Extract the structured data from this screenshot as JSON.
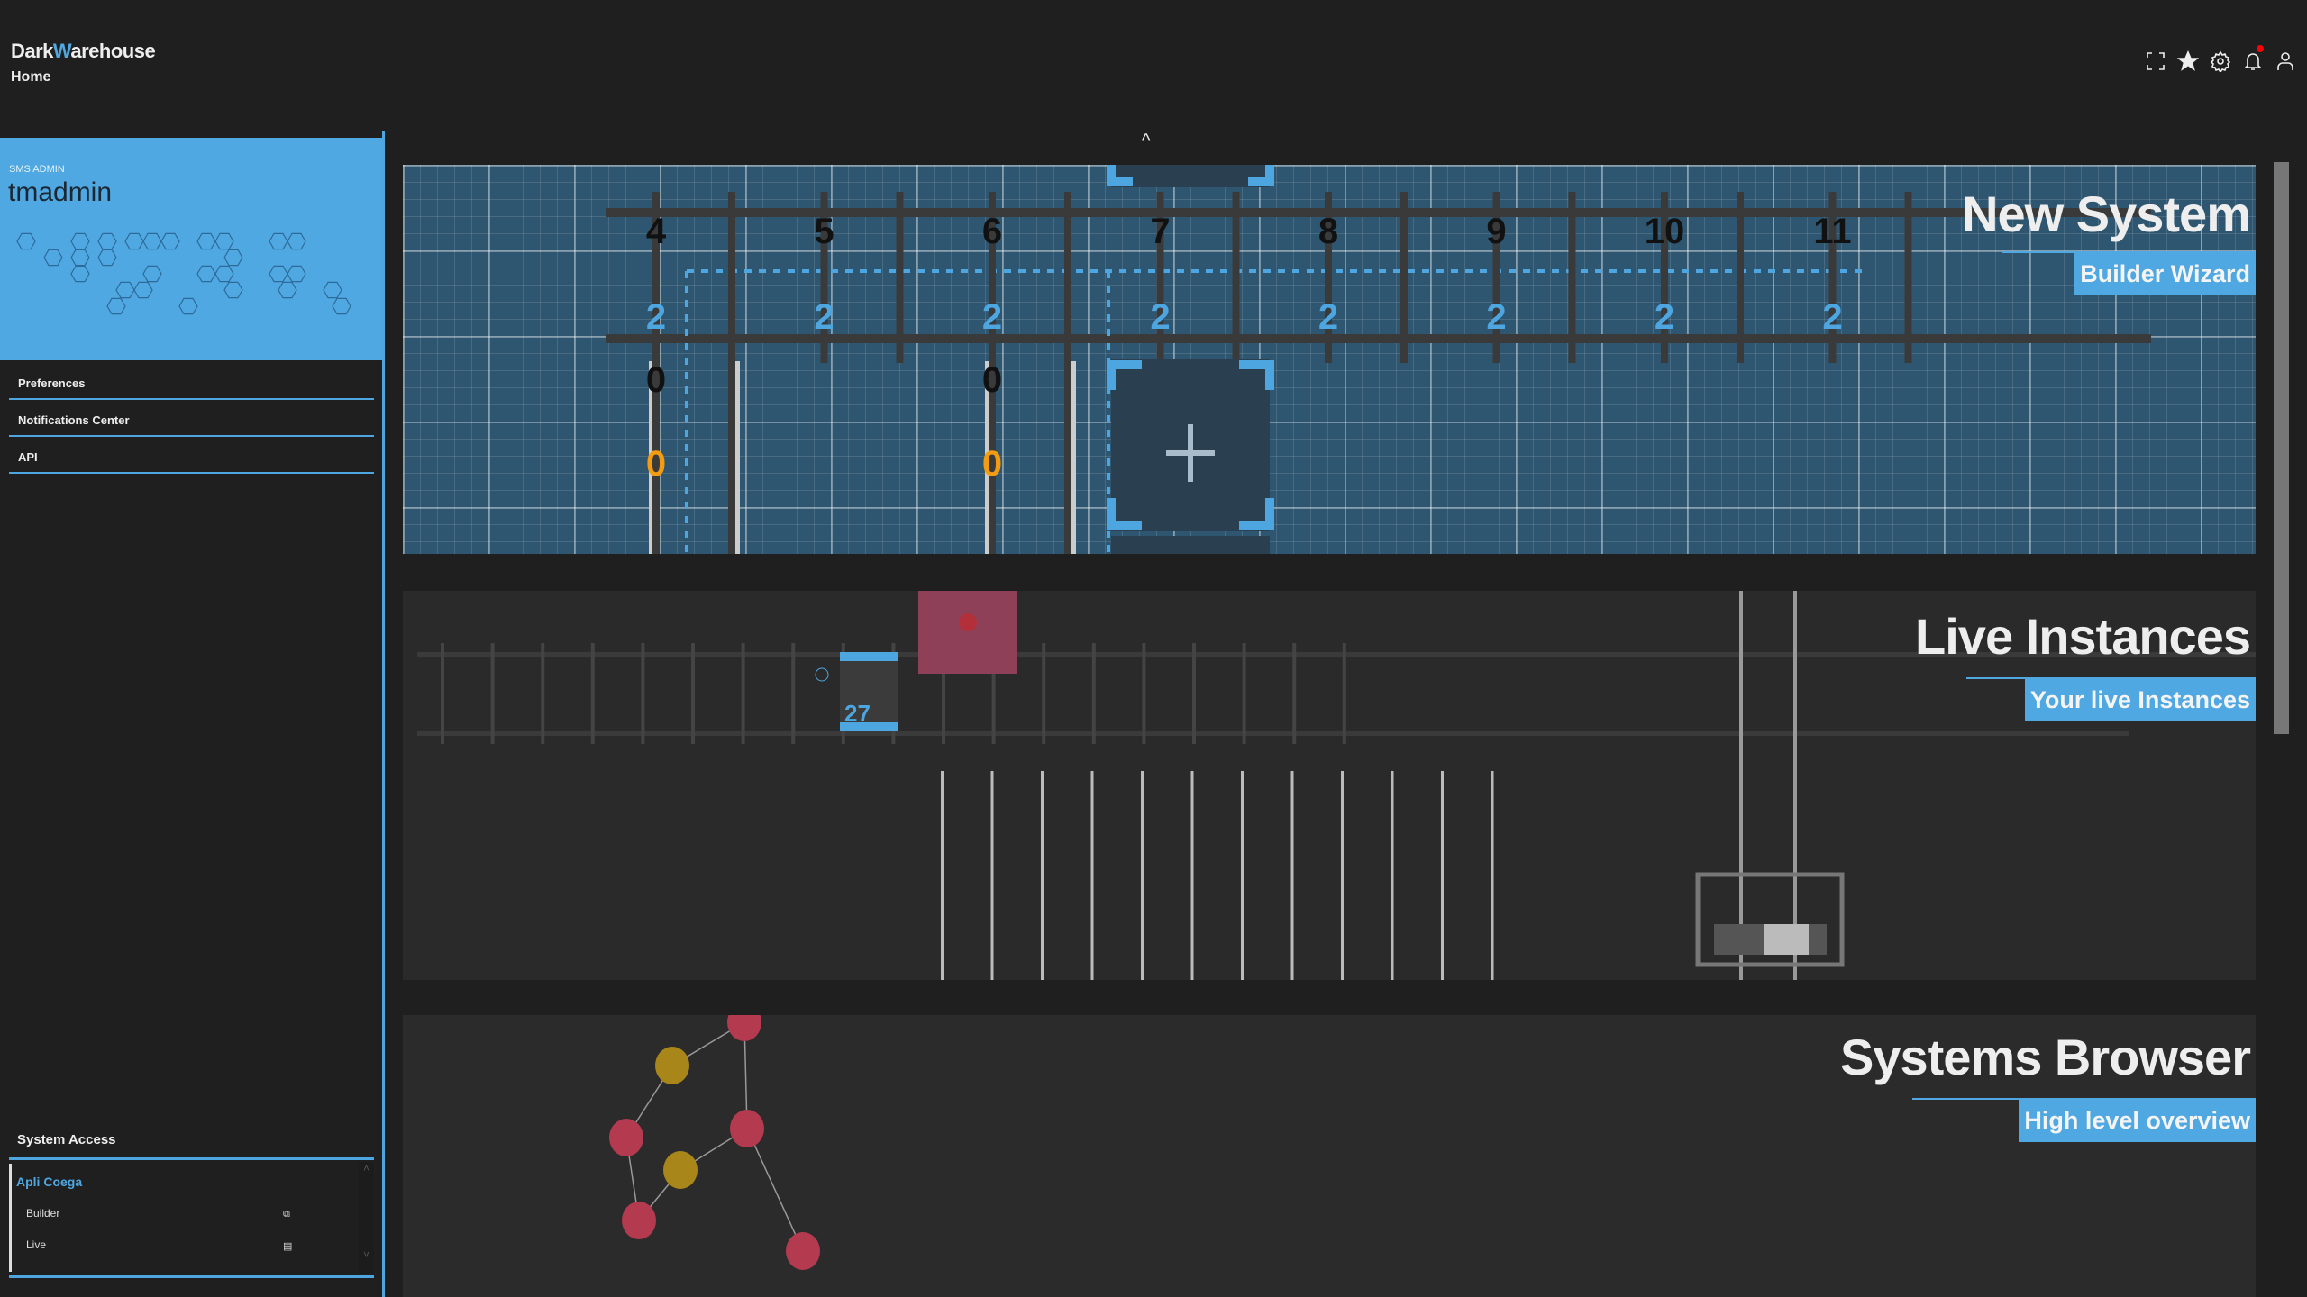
{
  "header": {
    "brand_a": "Dark",
    "brand_b": "W",
    "brand_c": "arehouse",
    "breadcrumb": "Home",
    "icons": [
      "fullscreen-icon",
      "star-icon",
      "gear-icon",
      "bell-icon",
      "user-icon"
    ],
    "notification_dot_color": "#ff0000"
  },
  "profile": {
    "role": "SMS ADMIN",
    "username": "tmadmin"
  },
  "menu": [
    {
      "label": "Preferences"
    },
    {
      "label": "Notifications Center"
    },
    {
      "label": "API"
    }
  ],
  "system_access": {
    "label": "System Access",
    "group": "Apli Coega",
    "items": [
      {
        "label": "Builder",
        "icon": "blueprint-icon"
      },
      {
        "label": "Live",
        "icon": "warehouse-icon"
      }
    ]
  },
  "tiles": [
    {
      "title": "New System",
      "subtitle": "Builder Wizard"
    },
    {
      "title": "Live Instances",
      "subtitle": "Your live Instances"
    },
    {
      "title": "Systems Browser",
      "subtitle": "High level overview"
    }
  ],
  "blueprint": {
    "columns": [
      "4",
      "5",
      "6",
      "7",
      "8",
      "9",
      "10",
      "11"
    ],
    "level": "2",
    "bays": [
      {
        "top": "0",
        "bottom": "0"
      },
      {
        "top": "0",
        "bottom": "0"
      }
    ]
  },
  "live": {
    "container_number": "27"
  },
  "colors": {
    "accent": "#4fa8e2",
    "orange": "#f39c12",
    "node_red": "#b33a4f",
    "node_yellow": "#a8861a"
  }
}
